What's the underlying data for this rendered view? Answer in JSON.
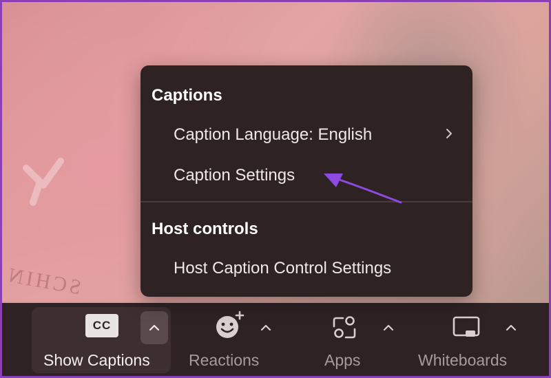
{
  "colors": {
    "menu_bg": "#2e2223",
    "toolbar_bg": "#2f2224",
    "annotation_arrow": "#8b4ae0",
    "frame_border": "#8a3fb5"
  },
  "video": {
    "shirt_text": "SCHIN"
  },
  "menu": {
    "sections": [
      {
        "title": "Captions",
        "items": [
          {
            "label": "Caption Language: English",
            "has_submenu": true,
            "submenu_icon": "chevron-right-icon"
          },
          {
            "label": "Caption Settings",
            "has_submenu": false
          }
        ]
      },
      {
        "title": "Host controls",
        "items": [
          {
            "label": "Host Caption Control Settings",
            "has_submenu": false
          }
        ]
      }
    ]
  },
  "toolbar": {
    "items": [
      {
        "label": "Show Captions",
        "icon": "cc-icon",
        "icon_text": "CC",
        "active": true,
        "caret": "chevron-up-icon"
      },
      {
        "label": "Reactions",
        "icon": "smiley-plus-icon",
        "active": false,
        "caret": "chevron-up-icon"
      },
      {
        "label": "Apps",
        "icon": "apps-icon",
        "active": false,
        "caret": "chevron-up-icon"
      },
      {
        "label": "Whiteboards",
        "icon": "whiteboard-icon",
        "active": false,
        "caret": "chevron-up-icon"
      }
    ]
  }
}
